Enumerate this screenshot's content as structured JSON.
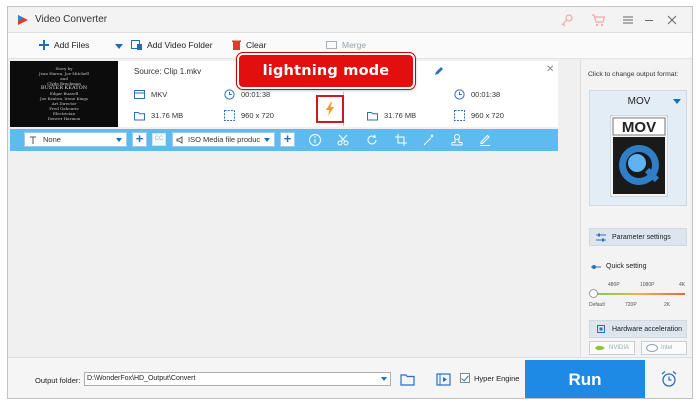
{
  "window": {
    "title": "Video Converter"
  },
  "toolbar": {
    "add_files": "Add Files",
    "add_folder": "Add Video Folder",
    "clear": "Clear",
    "merge": "Merge"
  },
  "file": {
    "source": "Source: Clip 1.mkv",
    "thumb_lines": [
      "Story by",
      "Jean Haron, Joe Mitchell",
      "and",
      "Clyde Bruckman",
      "BUSTER KEATON",
      "Edgar Buzzell",
      "Joe Keaton, Irene Kings",
      "Art Director",
      "Fred Gabourie",
      "Electrician",
      "Denver Harmon"
    ],
    "src_format": "MKV",
    "src_duration": "00:01:38",
    "src_size": "31.76 MB",
    "src_res": "960 x 720",
    "out_size": "31.76 MB",
    "out_duration": "00:01:38",
    "out_res": "960 x 720",
    "callout": "lightning mode"
  },
  "editbar": {
    "subtitle": "None",
    "cc": "CC",
    "audio": "ISO Media file produc"
  },
  "right_panel": {
    "change_label": "Click to change output format:",
    "format": "MOV",
    "icon_text": "MOV",
    "param_settings": "Parameter settings",
    "quick_setting": "Quick setting",
    "quality_top": [
      "480P",
      "1080P",
      "4K"
    ],
    "quality_bottom": [
      "Default",
      "720P",
      "2K"
    ],
    "quality_level": "Default",
    "hw_accel": "Hardware acceleration",
    "nvidia": "NVIDIA",
    "intel": "Intel"
  },
  "bottom": {
    "output_label": "Output folder:",
    "output_path": "D:\\WonderFox\\HD_Output\\Convert",
    "hyper_engine": "Hyper Engine",
    "hyper_checked": true,
    "run": "Run"
  },
  "colors": {
    "accent": "#1e8ae6",
    "editbar": "#5ebbf0",
    "callout": "#e30e0e",
    "lightning": "#f29b1c"
  }
}
